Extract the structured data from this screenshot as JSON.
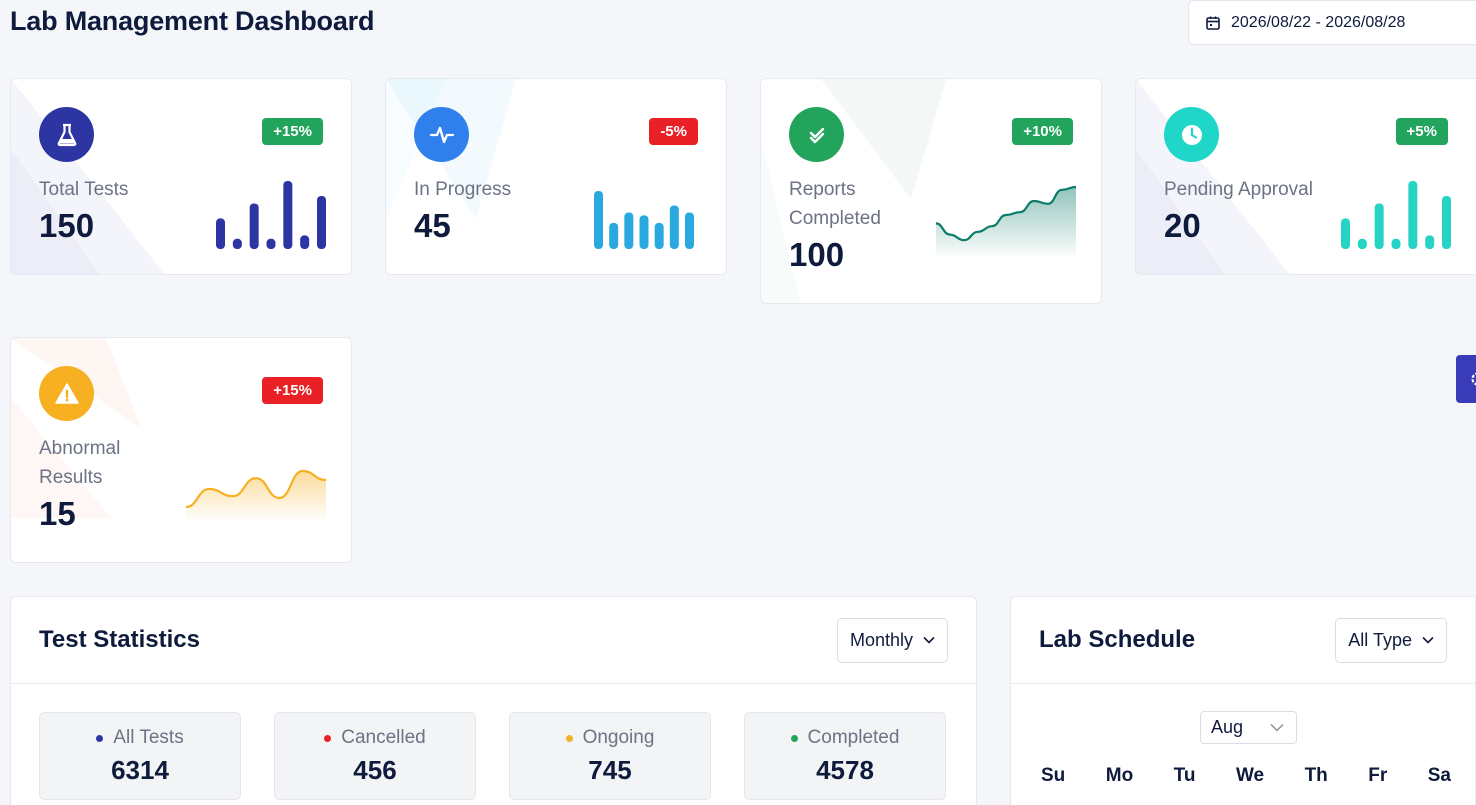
{
  "header": {
    "title": "Lab Management Dashboard",
    "date_range": "2026/08/22 - 2026/08/28",
    "date_icon": "calendar-icon"
  },
  "stats": [
    {
      "label": "Total Tests",
      "value": "150",
      "badge": "+15%",
      "badge_type": "positive",
      "icon": "flask-icon",
      "color": "#2d35a3",
      "spark": "bar",
      "spark_values": [
        0.45,
        0.15,
        0.67,
        0.15,
        1.0,
        0.2,
        0.78
      ]
    },
    {
      "label": "In Progress",
      "value": "45",
      "badge": "-5%",
      "badge_type": "negative",
      "icon": "activity-icon",
      "color": "#2aa9e0",
      "spark": "bar",
      "spark_values": [
        1.0,
        0.45,
        0.63,
        0.58,
        0.45,
        0.75,
        0.63
      ]
    },
    {
      "label": "Reports Completed",
      "value": "100",
      "badge": "+10%",
      "badge_type": "positive",
      "icon": "double-check-icon",
      "color": "#0c7c6a",
      "spark": "area",
      "spark_values": [
        0.35,
        0.15,
        0.05,
        0.2,
        0.3,
        0.5,
        0.55,
        0.75,
        0.7,
        0.95,
        1.0
      ]
    },
    {
      "label": "Pending Approval",
      "value": "20",
      "badge": "+5%",
      "badge_type": "positive",
      "icon": "clock-icon",
      "color": "#26d4c6",
      "spark": "bar",
      "spark_values": [
        0.45,
        0.15,
        0.67,
        0.15,
        1.0,
        0.2,
        0.78
      ]
    },
    {
      "label": "Abnormal Results",
      "value": "15",
      "badge": "+15%",
      "badge_type": "negative",
      "icon": "warning-icon",
      "color": "#f6b021",
      "spark": "area",
      "spark_values": [
        0.0,
        0.5,
        0.3,
        0.8,
        0.25,
        1.0,
        0.75
      ]
    }
  ],
  "test_statistics": {
    "title": "Test Statistics",
    "period": "Monthly",
    "summary": [
      {
        "label": "All Tests",
        "value": "6314",
        "color": "#2d35a3"
      },
      {
        "label": "Cancelled",
        "value": "456",
        "color": "#ea2027"
      },
      {
        "label": "Ongoing",
        "value": "745",
        "color": "#f0b429"
      },
      {
        "label": "Completed",
        "value": "4578",
        "color": "#22a45d"
      }
    ]
  },
  "lab_schedule": {
    "title": "Lab Schedule",
    "filter": "All Type",
    "month": "Aug",
    "weekdays": [
      "Su",
      "Mo",
      "Tu",
      "We",
      "Th",
      "Fr",
      "Sa"
    ]
  }
}
